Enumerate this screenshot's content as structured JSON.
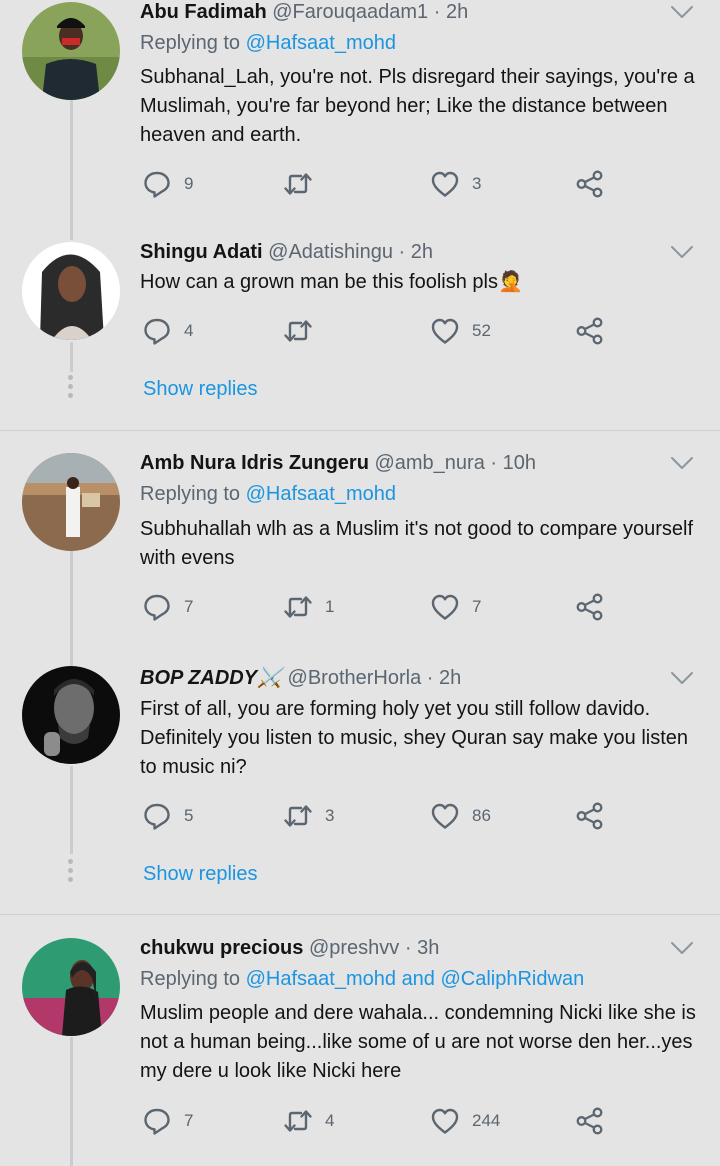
{
  "tweets": [
    {
      "name": "Abu Fadimah",
      "handle": "@Farouqaadam1",
      "dot": "·",
      "time": "2h",
      "replying_prefix": "Replying to ",
      "replying_mention": "@Hafsaat_mohd",
      "text": "Subhanal_Lah, you're not. Pls disregard their sayings, you're a Muslimah, you're far beyond her; Like the distance between heaven and earth.",
      "replies": "9",
      "retweets": "",
      "likes": "3"
    },
    {
      "name": "Shingu Adati",
      "handle": "@Adatishingu",
      "dot": "·",
      "time": "2h",
      "text": "How can a grown man be this foolish pls🤦",
      "replies": "4",
      "retweets": "",
      "likes": "52",
      "show_replies": "Show replies"
    },
    {
      "name": "Amb Nura Idris Zungeru",
      "handle": "@amb_nura",
      "dot": "·",
      "time": "10h",
      "replying_prefix": "Replying to ",
      "replying_mention": "@Hafsaat_mohd",
      "text": "Subhuhallah wlh as a Muslim it's not good to compare yourself with evens",
      "replies": "7",
      "retweets": "1",
      "likes": "7"
    },
    {
      "name": "BOP ZADDY⚔️",
      "handle": "@BrotherHorla",
      "dot": "·",
      "time": "2h",
      "text": "First of all, you are forming holy yet you still follow davido. Definitely you listen to music, shey Quran say make you listen to music ni?",
      "replies": "5",
      "retweets": "3",
      "likes": "86",
      "show_replies": "Show replies"
    },
    {
      "name": "chukwu precious",
      "handle": "@preshvv",
      "dot": "·",
      "time": "3h",
      "replying_prefix": "Replying to ",
      "replying_mention": "@Hafsaat_mohd and @CaliphRidwan",
      "text": "Muslim people and dere wahala... condemning Nicki like she is not a human being...like some of u are not worse den her...yes my dere u look like Nicki here",
      "replies": "7",
      "retweets": "4",
      "likes": "244"
    }
  ],
  "icons": {
    "reply": "reply-icon",
    "retweet": "retweet-icon",
    "like": "heart-icon",
    "share": "share-icon",
    "more": "chevron-down-icon"
  },
  "colors": {
    "background": "#e4e4e4",
    "link": "#1b95e0",
    "muted": "#5b6670",
    "thread_line": "#c9cdd1"
  }
}
